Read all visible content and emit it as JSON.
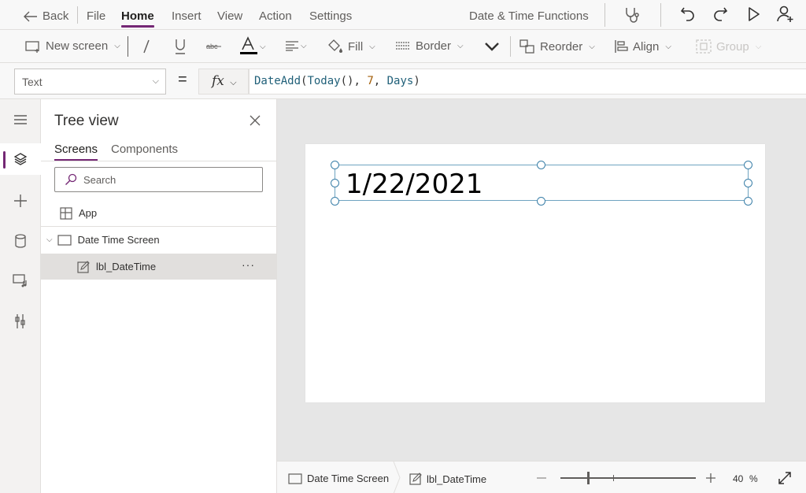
{
  "menu": {
    "back": "Back",
    "file": "File",
    "home": "Home",
    "insert": "Insert",
    "view": "View",
    "action": "Action",
    "settings": "Settings",
    "app_title": "Date & Time Functions"
  },
  "ribbon": {
    "new_screen": "New screen",
    "fill": "Fill",
    "border": "Border",
    "reorder": "Reorder",
    "align": "Align",
    "group": "Group"
  },
  "formula_bar": {
    "property": "Text",
    "equals": "=",
    "fx": "fx",
    "tokens": [
      "DateAdd",
      "(",
      "Today",
      "(), ",
      "7",
      ", ",
      "Days",
      ")"
    ]
  },
  "tree": {
    "title": "Tree view",
    "tabs": [
      "Screens",
      "Components"
    ],
    "search_placeholder": "Search",
    "items": {
      "app": "App",
      "screen": "Date Time Screen",
      "control": "lbl_DateTime"
    },
    "more": "···"
  },
  "canvas": {
    "label_text": "1/22/2021"
  },
  "status": {
    "screen": "Date Time Screen",
    "control": "lbl_DateTime",
    "zoom_value": "40",
    "zoom_unit": "%",
    "zoom_fraction": 0.2
  },
  "colors": {
    "accent": "#742774",
    "formula_function": "#206079",
    "formula_number": "#a15c07",
    "selection": "#3a7fa8"
  },
  "icons": [
    "back-arrow-icon",
    "stethoscope-icon",
    "undo-icon",
    "redo-icon",
    "play-icon",
    "add-user-icon",
    "new-screen-icon",
    "italic-icon",
    "underline-icon",
    "strikethrough-icon",
    "font-color-icon",
    "text-align-icon",
    "fill-icon",
    "border-icon",
    "reorder-icon",
    "align-icon",
    "group-icon",
    "hamburger-icon",
    "layers-icon",
    "plus-icon",
    "database-icon",
    "media-icon",
    "tools-icon",
    "close-icon",
    "search-icon",
    "app-icon",
    "screen-icon",
    "edit-label-icon",
    "expand-icon"
  ]
}
